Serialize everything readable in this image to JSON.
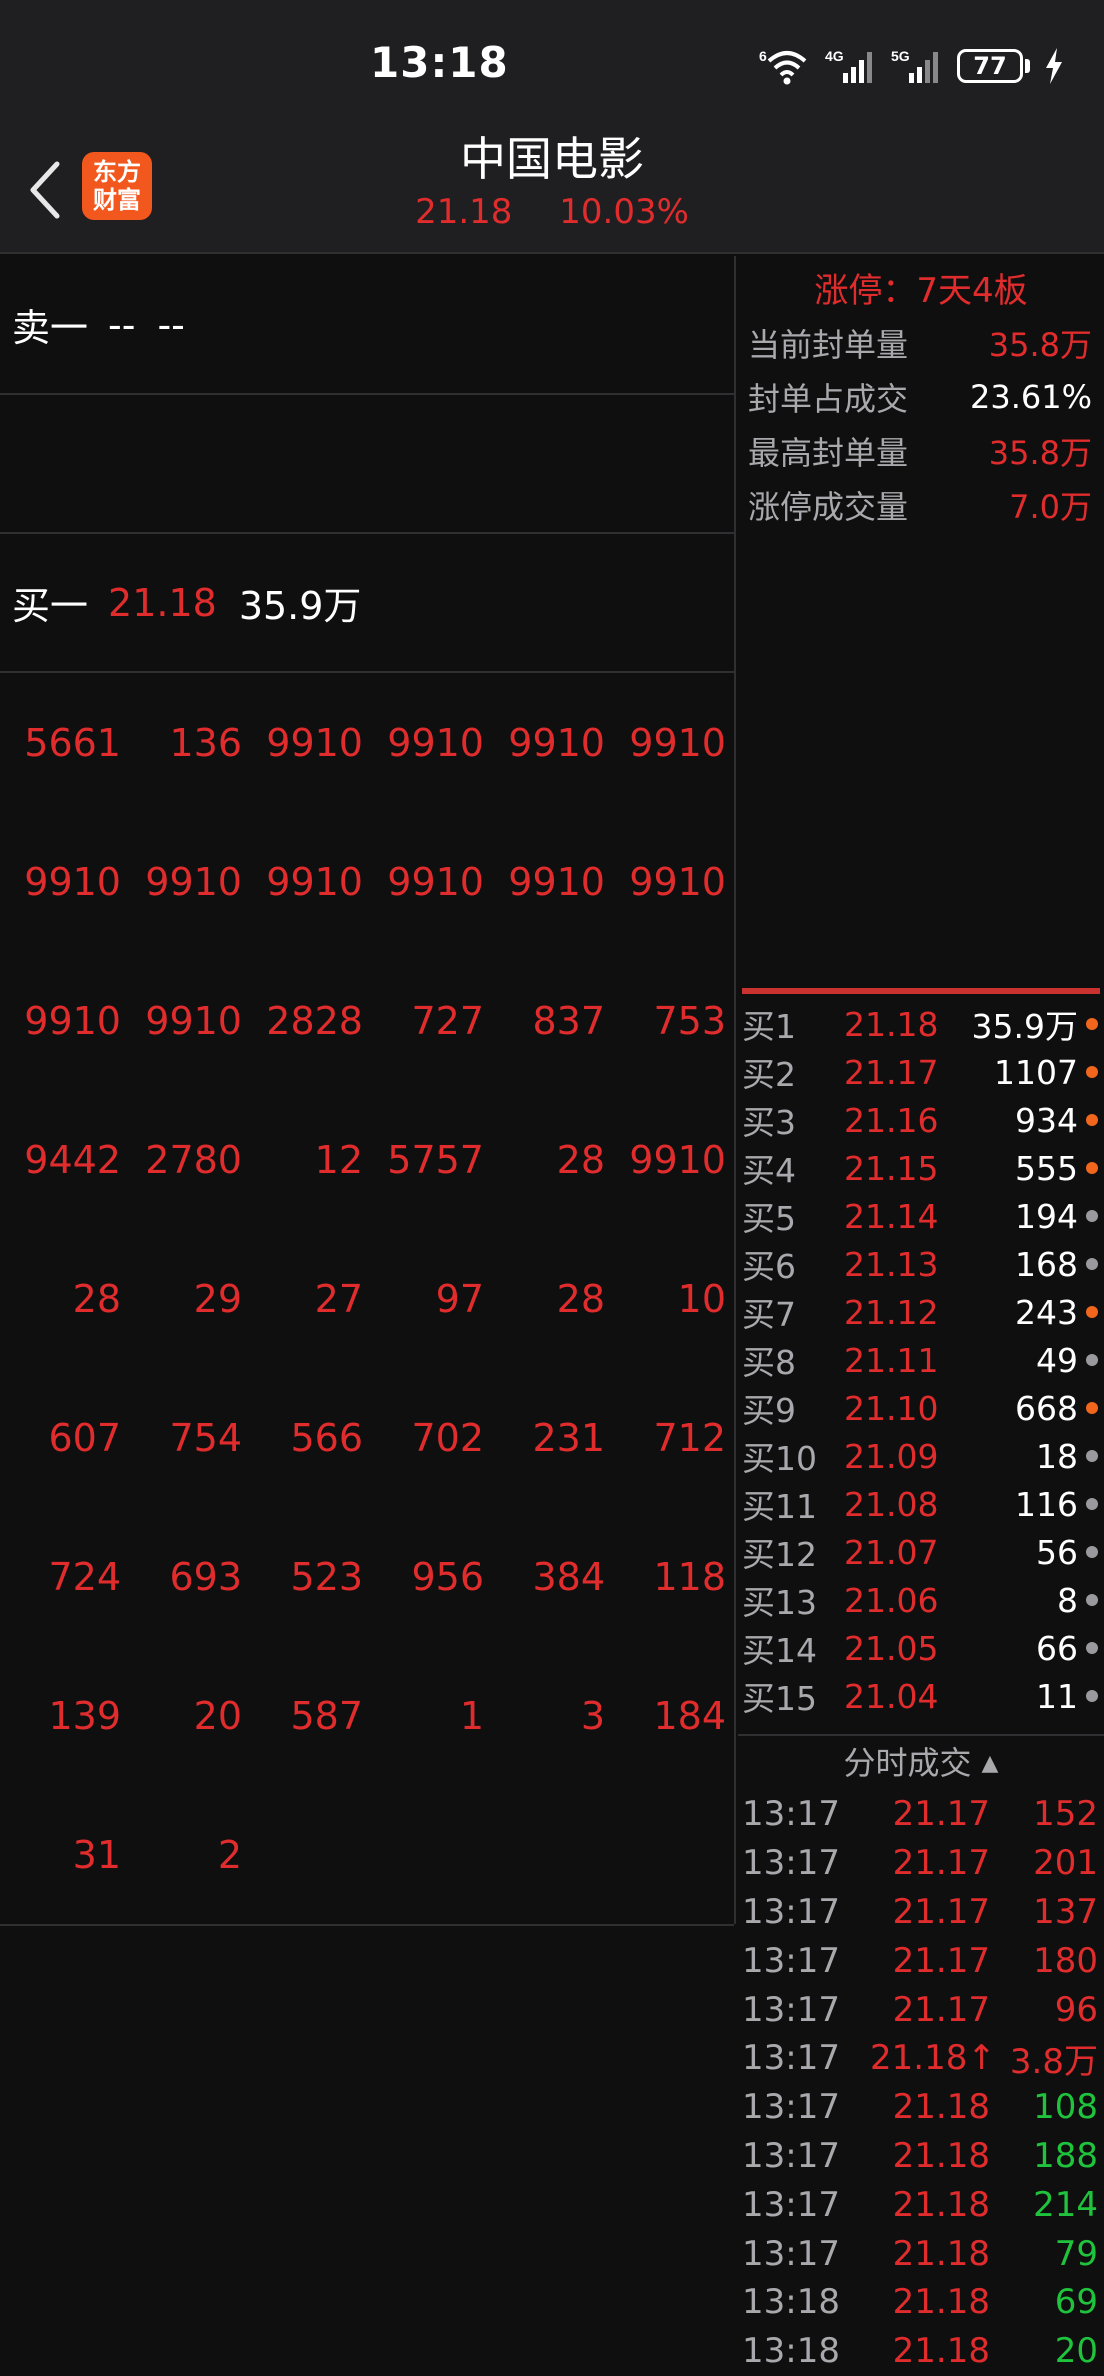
{
  "status_bar": {
    "time": "13:18",
    "wifi_badge": "6",
    "net1": "4G",
    "net2": "5G",
    "battery": "77"
  },
  "header": {
    "logo_line1": "东方",
    "logo_line2": "财富",
    "title": "中国电影",
    "price": "21.18",
    "change_pct": "10.03%"
  },
  "order_book_summary": {
    "sell_label": "卖一",
    "sell_price": "--",
    "sell_volume": "--",
    "buy_label": "买一",
    "buy_price": "21.18",
    "buy_volume": "35.9万"
  },
  "order_queue": [
    [
      "5661",
      "136",
      "9910",
      "9910",
      "9910",
      "9910"
    ],
    [
      "9910",
      "9910",
      "9910",
      "9910",
      "9910",
      "9910"
    ],
    [
      "9910",
      "9910",
      "2828",
      "727",
      "837",
      "753"
    ],
    [
      "9442",
      "2780",
      "12",
      "5757",
      "28",
      "9910"
    ],
    [
      "28",
      "29",
      "27",
      "97",
      "28",
      "10"
    ],
    [
      "607",
      "754",
      "566",
      "702",
      "231",
      "712"
    ],
    [
      "724",
      "693",
      "523",
      "956",
      "384",
      "118"
    ],
    [
      "139",
      "20",
      "587",
      "1",
      "3",
      "184"
    ],
    [
      "31",
      "2",
      "",
      "",
      "",
      ""
    ]
  ],
  "limit_up": {
    "title": "涨停：7天4板",
    "stats": [
      {
        "label": "当前封单量",
        "value": "35.8万",
        "color": "red"
      },
      {
        "label": "封单占成交",
        "value": "23.61%",
        "color": "white"
      },
      {
        "label": "最高封单量",
        "value": "35.8万",
        "color": "red"
      },
      {
        "label": "涨停成交量",
        "value": "7.0万",
        "color": "red"
      }
    ]
  },
  "bids": [
    {
      "label": "买1",
      "price": "21.18",
      "volume": "35.9万",
      "dot": "orange"
    },
    {
      "label": "买2",
      "price": "21.17",
      "volume": "1107",
      "dot": "orange"
    },
    {
      "label": "买3",
      "price": "21.16",
      "volume": "934",
      "dot": "orange"
    },
    {
      "label": "买4",
      "price": "21.15",
      "volume": "555",
      "dot": "orange"
    },
    {
      "label": "买5",
      "price": "21.14",
      "volume": "194",
      "dot": "grey"
    },
    {
      "label": "买6",
      "price": "21.13",
      "volume": "168",
      "dot": "grey"
    },
    {
      "label": "买7",
      "price": "21.12",
      "volume": "243",
      "dot": "orange"
    },
    {
      "label": "买8",
      "price": "21.11",
      "volume": "49",
      "dot": "grey"
    },
    {
      "label": "买9",
      "price": "21.10",
      "volume": "668",
      "dot": "orange"
    },
    {
      "label": "买10",
      "price": "21.09",
      "volume": "18",
      "dot": "grey"
    },
    {
      "label": "买11",
      "price": "21.08",
      "volume": "116",
      "dot": "grey"
    },
    {
      "label": "买12",
      "price": "21.07",
      "volume": "56",
      "dot": "grey"
    },
    {
      "label": "买13",
      "price": "21.06",
      "volume": "8",
      "dot": "grey"
    },
    {
      "label": "买14",
      "price": "21.05",
      "volume": "66",
      "dot": "grey"
    },
    {
      "label": "买15",
      "price": "21.04",
      "volume": "11",
      "dot": "grey"
    }
  ],
  "ticks_header": "分时成交",
  "ticks": [
    {
      "time": "13:17",
      "price": "21.17",
      "volume": "152",
      "color": "red"
    },
    {
      "time": "13:17",
      "price": "21.17",
      "volume": "201",
      "color": "red"
    },
    {
      "time": "13:17",
      "price": "21.17",
      "volume": "137",
      "color": "red"
    },
    {
      "time": "13:17",
      "price": "21.17",
      "volume": "180",
      "color": "red"
    },
    {
      "time": "13:17",
      "price": "21.17",
      "volume": "96",
      "color": "red"
    },
    {
      "time": "13:17",
      "price": "21.18↑",
      "volume": "3.8万",
      "color": "red"
    },
    {
      "time": "13:17",
      "price": "21.18",
      "volume": "108",
      "color": "green"
    },
    {
      "time": "13:17",
      "price": "21.18",
      "volume": "188",
      "color": "green"
    },
    {
      "time": "13:17",
      "price": "21.18",
      "volume": "214",
      "color": "green"
    },
    {
      "time": "13:17",
      "price": "21.18",
      "volume": "79",
      "color": "green"
    },
    {
      "time": "13:18",
      "price": "21.18",
      "volume": "69",
      "color": "green"
    },
    {
      "time": "13:18",
      "price": "21.18",
      "volume": "20",
      "color": "green"
    }
  ],
  "colors": {
    "up_red": "#e02c2c",
    "down_green": "#1fc43c",
    "background": "#0f0f10",
    "brand_orange": "#f2571d"
  }
}
